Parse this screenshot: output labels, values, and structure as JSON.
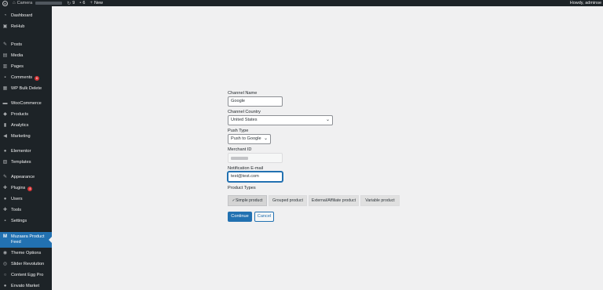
{
  "admin_bar": {
    "site_name": "Camera",
    "updates_count": "9",
    "comments_count": "6",
    "new_label": "New",
    "howdy": "Howdy, adminse"
  },
  "sidebar": {
    "items": [
      {
        "label": "Dashboard",
        "icon": "dashboard-icon"
      },
      {
        "label": "ReHub",
        "icon": "rehub-icon"
      },
      {
        "label": "Posts",
        "icon": "pin-icon"
      },
      {
        "label": "Media",
        "icon": "media-icon"
      },
      {
        "label": "Pages",
        "icon": "pages-icon"
      },
      {
        "label": "Comments",
        "icon": "comments-icon",
        "badge": "6"
      },
      {
        "label": "WP Bulk Delete",
        "icon": "trash-icon"
      },
      {
        "label": "WooCommerce",
        "icon": "woocommerce-icon"
      },
      {
        "label": "Products",
        "icon": "products-icon"
      },
      {
        "label": "Analytics",
        "icon": "analytics-icon"
      },
      {
        "label": "Marketing",
        "icon": "megaphone-icon"
      },
      {
        "label": "Elementor",
        "icon": "elementor-icon"
      },
      {
        "label": "Templates",
        "icon": "templates-icon"
      },
      {
        "label": "Appearance",
        "icon": "brush-icon"
      },
      {
        "label": "Plugins",
        "icon": "plugin-icon",
        "badge": "4"
      },
      {
        "label": "Users",
        "icon": "users-icon"
      },
      {
        "label": "Tools",
        "icon": "tools-icon"
      },
      {
        "label": "Settings",
        "icon": "settings-icon"
      },
      {
        "label": "Muzaara Product Feed",
        "icon": "muzaara-logo-icon",
        "active": true
      },
      {
        "label": "Theme Options",
        "icon": "theme-options-icon"
      },
      {
        "label": "Slider Revolution",
        "icon": "slider-icon"
      },
      {
        "label": "Content Egg Pro",
        "icon": "egg-icon"
      },
      {
        "label": "Envato Market",
        "icon": "envato-icon"
      }
    ]
  },
  "form": {
    "channel_name_label": "Channel Name",
    "channel_name_value": "Google",
    "channel_country_label": "Channel Country",
    "channel_country_value": "United States",
    "push_type_label": "Push Type",
    "push_type_value": "Push to Google",
    "merchant_id_label": "Merchant ID",
    "notification_email_label": "Notification E-mail",
    "notification_email_value": "test@test.com",
    "product_types_label": "Product Types",
    "product_types": [
      {
        "label": "Simple product",
        "selected": true
      },
      {
        "label": "Grouped product",
        "selected": false
      },
      {
        "label": "External/Affiliate product",
        "selected": false
      },
      {
        "label": "Variable product",
        "selected": false
      }
    ],
    "continue_label": "Continue",
    "cancel_label": "Cancel"
  },
  "colors": {
    "admin_bg": "#1d2327",
    "accent": "#2271b1",
    "page_bg": "#f0f0f1",
    "badge": "#d63638"
  }
}
